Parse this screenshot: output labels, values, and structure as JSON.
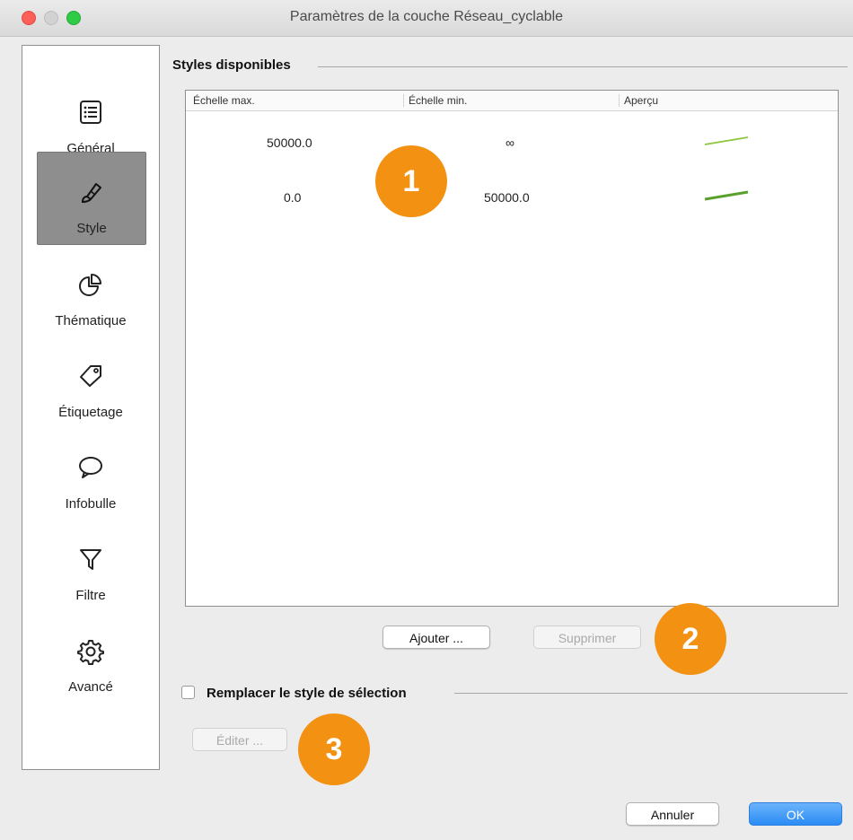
{
  "window": {
    "title": "Paramètres de la couche Réseau_cyclable"
  },
  "sidebar": {
    "items": [
      {
        "label": "Général",
        "icon": "list-icon",
        "active": false
      },
      {
        "label": "Style",
        "icon": "paintbrush-icon",
        "active": true
      },
      {
        "label": "Thématique",
        "icon": "pie-chart-icon",
        "active": false
      },
      {
        "label": "Étiquetage",
        "icon": "tag-icon",
        "active": false
      },
      {
        "label": "Infobulle",
        "icon": "speech-bubble-icon",
        "active": false
      },
      {
        "label": "Filtre",
        "icon": "filter-icon",
        "active": false
      },
      {
        "label": "Avancé",
        "icon": "gear-icon",
        "active": false
      }
    ]
  },
  "styles": {
    "section_title": "Styles disponibles",
    "columns": [
      "Échelle max.",
      "Échelle min.",
      "Aperçu"
    ],
    "rows": [
      {
        "max": "50000.0",
        "min": "∞",
        "preview_color": "#8cc63f"
      },
      {
        "max": "0.0",
        "min": "50000.0",
        "preview_color": "#5aa02c"
      }
    ],
    "add_label": "Ajouter ...",
    "delete_label": "Supprimer"
  },
  "selection": {
    "label": "Remplacer le style de sélection",
    "checked": false,
    "edit_label": "Éditer ..."
  },
  "footer": {
    "cancel_label": "Annuler",
    "ok_label": "OK"
  },
  "callouts": {
    "one": "1",
    "two": "2",
    "three": "3",
    "color": "#f39112"
  }
}
